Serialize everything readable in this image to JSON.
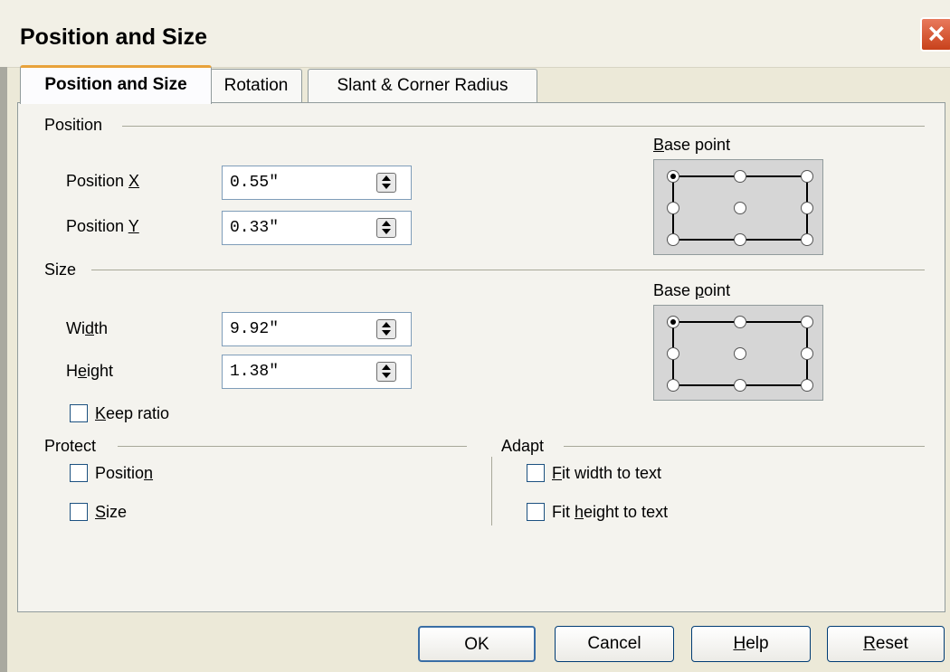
{
  "window": {
    "title": "Position and Size"
  },
  "tabs": [
    {
      "label": "Position and Size",
      "active": true
    },
    {
      "label": "Rotation",
      "active": false
    },
    {
      "label": "Slant & Corner Radius",
      "active": false
    }
  ],
  "position": {
    "heading": "Position",
    "x": {
      "label_pre": "Position ",
      "label_key": "X",
      "label_post": "",
      "value": "0.55\""
    },
    "y": {
      "label_pre": "Position ",
      "label_key": "Y",
      "label_post": "",
      "value": "0.33\""
    },
    "base_point": {
      "label_key": "B",
      "label_rest": "ase point",
      "selected": "top-left"
    }
  },
  "size": {
    "heading": "Size",
    "width": {
      "label_pre": "Wi",
      "label_key": "d",
      "label_post": "th",
      "value": "9.92\""
    },
    "height": {
      "label_pre": "H",
      "label_key": "e",
      "label_post": "ight",
      "value": "1.38\""
    },
    "keep_ratio": {
      "label_key": "K",
      "label_rest": "eep ratio",
      "checked": false
    },
    "base_point": {
      "label_pre": "Base ",
      "label_key": "p",
      "label_post": "oint",
      "selected": "top-left"
    }
  },
  "protect": {
    "heading": "Protect",
    "position": {
      "label_pre": "Positio",
      "label_key": "n",
      "checked": false
    },
    "size": {
      "label_key": "S",
      "label_rest": "ize",
      "checked": false
    }
  },
  "adapt": {
    "heading": "Adapt",
    "fit_width": {
      "label_key": "F",
      "label_rest": "it width to text",
      "checked": false
    },
    "fit_height": {
      "label_pre": "Fit ",
      "label_key": "h",
      "label_post": "eight to text",
      "checked": false
    }
  },
  "buttons": {
    "ok": "OK",
    "cancel": "Cancel",
    "help_key": "H",
    "help_rest": "elp",
    "reset_key": "R",
    "reset_rest": "eset"
  },
  "icons": {
    "close": "close-icon",
    "spin": "spin-button-icon"
  },
  "colors": {
    "active_tab_accent": "#e8a23a",
    "close_button": "#c8411b",
    "dialog_bg": "#ece9d8"
  }
}
